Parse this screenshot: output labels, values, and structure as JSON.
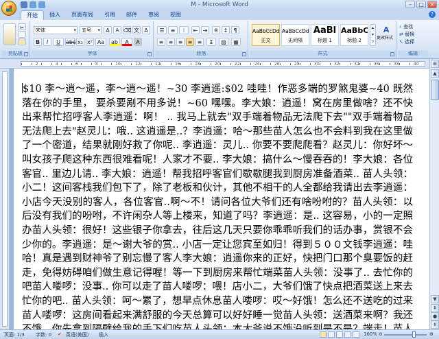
{
  "window": {
    "title": "M - Microsoft Word"
  },
  "tabs": [
    {
      "label": "开始"
    },
    {
      "label": "插入"
    },
    {
      "label": "页面布局"
    },
    {
      "label": "引用"
    },
    {
      "label": "邮件"
    },
    {
      "label": "审阅"
    },
    {
      "label": "视图"
    }
  ],
  "ribbon": {
    "font_name": "宋体",
    "font_size": "五号",
    "groups": {
      "clipboard": "剪贴板",
      "font": "字体",
      "paragraph": "段落",
      "styles": "样式",
      "editing": "编辑"
    },
    "styles": [
      {
        "sample": "AaBbCcDd",
        "name": "正文"
      },
      {
        "sample": "AaBbCcDd",
        "name": "无间隔"
      },
      {
        "sample": "AaBl",
        "name": "标题 1"
      },
      {
        "sample": "AaBbC",
        "name": "标题 2"
      }
    ],
    "change_styles": "更改样式",
    "find": "查找",
    "replace": "替换",
    "select": "选择"
  },
  "ruler_numbers": [
    "2",
    "4",
    "6",
    "8",
    "10",
    "12",
    "14",
    "16",
    "18",
    "20",
    "22",
    "24",
    "26",
    "28",
    "30",
    "32",
    "34",
    "36",
    "38",
    "40"
  ],
  "document": {
    "text": "$10 李～逍～遥，李～逍～遥！~30 李逍遥:$02 哇哇！作恶多端的罗煞鬼婆~40 既然落在你的手里， 要杀要剐不用多说！~60 嘿嘿。李大娘：逍遥！窝在房里做啥？还不快出来帮忙招呼客人李逍遥：啊！ .. 我马上就去\"双手端着物品无法爬下去\"\"双手端着物品无法爬上去\"赵灵儿：哦.. 这逍遥是..？李逍遥：哈～那些苗人怎么也不会料到我在这里做了一个密道，结果就刚好救了你呢.. 李逍遥：灵儿.. 你要不要爬爬看？赵灵儿：你好坏～叫女孩子爬这种东西很难看呢！人家才不要.. 李大娘：搞什么～慢吞吞的！李大娘：各位客官.. 里边儿请.. 李大娘：逍遥！帮我招呼客官们歇歇腿我到厨房准备酒菜.. 苗人头领：小二！这间客栈我们包下了，除了老板和伙计，其他不相干的人全都给我请出去李逍遥：小店今天没别的客人，各位客官..啊～不！请问各位大爷们还有啥吩咐的？苗人头领：以后没有我们的吩咐，不许闲杂人等上楼来，知道了吗？李逍遥：是.. 这容易，小的一定照办苗人头领：很好！这些银子你拿去，往后这几天只要你乖乖听我们的话办事，赏银不会少你的。李逍遥：是～谢大爷的赏.. 小店一定让您宾至如归！得到５００文钱李逍遥：哇哈！真是遇到财神爷了别忘慢了客人李大娘：逍遥你来的正好，快把门口那个臭要饭的赶走，免得妨碍咱们做生意记得喔！等一下到厨房来帮忙端菜苗人头领：没事了.. 去忙你的吧苗人喽啰：没事.. 你可以走了苗人喽啰：喂！店小二，大爷们饿了快点把酒菜送上来去忙你的吧.. 苗人头领：呵～累了，想早点休息苗人喽啰：哎～好饿！怎么还不送吃的过来苗人喽啰：这房间看起来满舒服的今天总算可以好好睡一觉苗人头领：送酒菜来啊？我还不饿，你先拿到隔壁给我的手下们吃苗人头领：本大爷说不饿没听到是不是？端走！苗人头领：你去忙吧.. 有事我再叫你苗人喽啰："
  },
  "statusbar": {
    "page": "页面: 1/3",
    "words": "字数: 0",
    "language": "英语(美国)",
    "mode": "插入",
    "zoom": "160%",
    "zoom_level": 0.7
  }
}
